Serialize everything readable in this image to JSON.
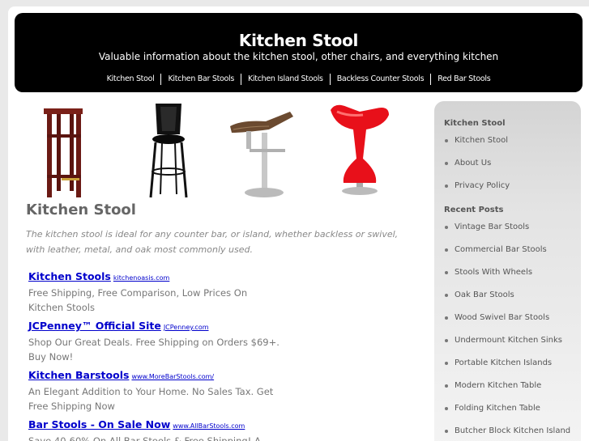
{
  "header": {
    "title": "Kitchen Stool",
    "description": "Valuable information about the kitchen stool, other chairs, and everything kitchen",
    "nav": [
      "Kitchen Stool",
      "Kitchen Bar Stools",
      "Kitchen Island Stools",
      "Backless Counter Stools",
      "Red Bar Stools"
    ]
  },
  "main": {
    "title": "Kitchen Stool",
    "intro": "The kitchen stool is ideal for any counter bar, or island, whether backless or swivel, with leather, metal, and oak most commonly used."
  },
  "ads": [
    {
      "title": "Kitchen Stools",
      "url": "kitchenoasis.com",
      "desc": "Free Shipping, Free Comparison, Low Prices On Kitchen Stools"
    },
    {
      "title": "JCPenney™ Official Site",
      "url": "JCPenney.com",
      "desc": "Shop Our Great Deals. Free Shipping on Orders $69+. Buy Now!"
    },
    {
      "title": "Kitchen Barstools",
      "url": "www.MoreBarStools.com/",
      "desc": "An Elegant Addition to Your Home. No Sales Tax. Get Free Shipping Now"
    },
    {
      "title": "Bar Stools - On Sale Now",
      "url": "www.AllBarStools.com",
      "desc": "Save 40-60% On All Bar Stools & Free Shipping! A"
    }
  ],
  "sidebar": {
    "pages_heading": "Kitchen Stool",
    "pages": [
      "Kitchen Stool",
      "About Us",
      "Privacy Policy"
    ],
    "recent_heading": "Recent Posts",
    "recent": [
      "Vintage Bar Stools",
      "Commercial Bar Stools",
      "Stools With Wheels",
      "Oak Bar Stools",
      "Wood Swivel Bar Stools",
      "Undermount Kitchen Sinks",
      "Portable Kitchen Islands",
      "Modern Kitchen Table",
      "Folding Kitchen Table",
      "Butcher Block Kitchen Island"
    ]
  },
  "colors": {
    "header_bg": "#000000",
    "link": "#0000cc",
    "red_stool": "#e8101a",
    "wood_stool": "#6b1a14"
  }
}
